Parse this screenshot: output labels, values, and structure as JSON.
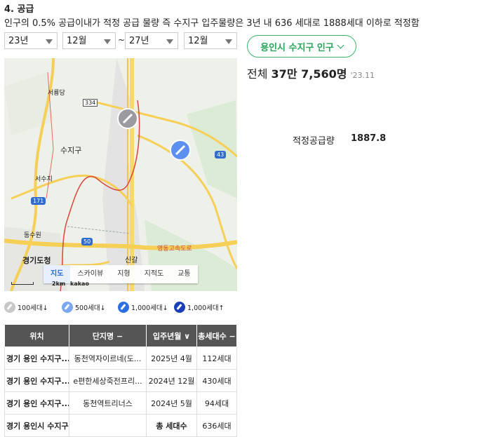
{
  "section": {
    "heading": "4. 공급",
    "description": "인구의 0.5% 공급이내가 적정 공급 물량 즉 수지구 입주물량은 3년 내 636 세대로 1888세대 이하로 적정함"
  },
  "filters": {
    "start_year": "23년",
    "start_month": "12월",
    "separator": "~",
    "end_year": "27년",
    "end_month": "12월"
  },
  "region_button": {
    "label": "용인시 수지구 인구"
  },
  "population": {
    "prefix": "전체",
    "value": "37만 7,560명",
    "date": "'23.11"
  },
  "supply": {
    "label": "적정공급량",
    "value": "1887.8"
  },
  "map": {
    "tabs": [
      "지도",
      "스카이뷰",
      "지형",
      "지적도",
      "교통"
    ],
    "active_tab": "지도",
    "place_labels": [
      "서룡당",
      "수지구",
      "서수지",
      "동수원",
      "경기도청",
      "신갈",
      "영동고속도로"
    ],
    "route_shields": [
      "334",
      "43",
      "171",
      "50"
    ],
    "scale_label": "2km",
    "logo": "kakao"
  },
  "legend": [
    {
      "label": "100세대↓",
      "color": "#c8c8cc"
    },
    {
      "label": "500세대↓",
      "color": "#7aa8f0"
    },
    {
      "label": "1,000세대↓",
      "color": "#2b6fe0"
    },
    {
      "label": "1,000세대↑",
      "color": "#1a3fb8"
    }
  ],
  "table": {
    "headers": [
      "위치",
      "단지명 −",
      "입주년월 ∨",
      "총세대수 −"
    ],
    "rows": [
      [
        "경기 용인 수지구...",
        "동천역자이르네(도...",
        "2025년 4월",
        "112세대"
      ],
      [
        "경기 용인 수지구...",
        "e편한세상죽전프리...",
        "2024년 12월",
        "430세대"
      ],
      [
        "경기 용인 수지구...",
        "동천역트리너스",
        "2024년 5월",
        "94세대"
      ],
      [
        "경기 용인시 수지구",
        "",
        "총 세대수",
        "636세대"
      ]
    ]
  }
}
